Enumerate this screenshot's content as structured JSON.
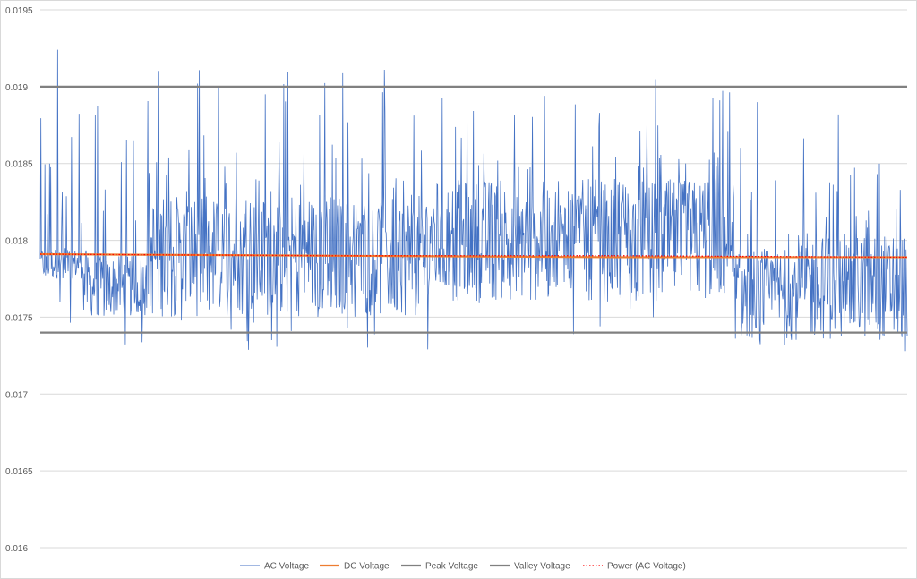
{
  "chart_data": {
    "type": "line",
    "title": "",
    "xlabel": "",
    "ylabel": "",
    "ylim": [
      0.016,
      0.0195
    ],
    "y_ticks": [
      "0.016",
      "0.0165",
      "0.017",
      "0.0175",
      "0.018",
      "0.0185",
      "0.019",
      "0.0195"
    ],
    "grid": true,
    "legend_position": "bottom",
    "point_count": 1500,
    "series": [
      {
        "name": "AC Voltage",
        "color": "#4472C4",
        "style": "solid-thin",
        "envelope": {
          "min": 0.01728,
          "max": 0.01924,
          "segments": [
            {
              "x_start": 0,
              "x_end": 0.05,
              "base": 0.01785,
              "spread": 0.0001,
              "spike_max": 0.01924
            },
            {
              "x_start": 0.05,
              "x_end": 0.12,
              "base": 0.0177,
              "spread": 0.0002,
              "spike_max": 0.0189
            },
            {
              "x_start": 0.12,
              "x_end": 0.45,
              "base": 0.0179,
              "spread": 0.0004,
              "spike_max": 0.01915
            },
            {
              "x_start": 0.45,
              "x_end": 0.8,
              "base": 0.018,
              "spread": 0.0004,
              "spike_max": 0.01906
            },
            {
              "x_start": 0.8,
              "x_end": 0.87,
              "base": 0.01765,
              "spread": 0.0003,
              "spike_max": 0.01898
            },
            {
              "x_start": 0.87,
              "x_end": 1.0,
              "base": 0.0177,
              "spread": 0.00035,
              "spike_max": 0.01902
            }
          ]
        }
      },
      {
        "name": "DC Voltage",
        "color": "#ED7D31",
        "style": "solid",
        "values": [
          0.01791,
          0.0179,
          0.01789,
          0.01789
        ]
      },
      {
        "name": "Peak Voltage",
        "color": "#808080",
        "style": "solid",
        "values": [
          0.019,
          0.019
        ]
      },
      {
        "name": "Valley Voltage",
        "color": "#808080",
        "style": "solid",
        "values": [
          0.0174,
          0.0174
        ]
      },
      {
        "name": "Power (AC Voltage)",
        "color": "#FF0000",
        "style": "dotted",
        "values": [
          0.01791,
          0.0179,
          0.0179,
          0.01789
        ]
      }
    ]
  }
}
